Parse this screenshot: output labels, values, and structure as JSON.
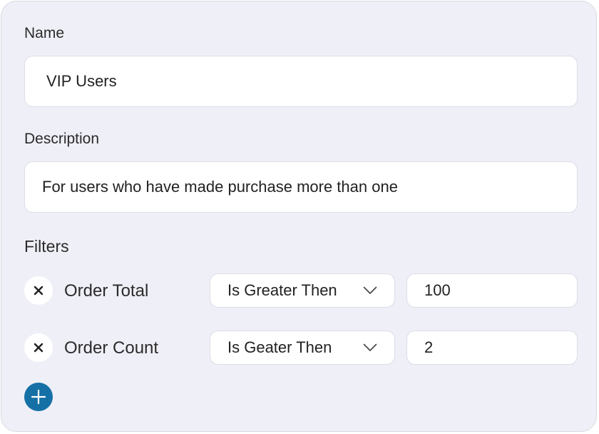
{
  "form": {
    "name_label": "Name",
    "name_value": "VIP Users",
    "description_label": "Description",
    "description_value": "For users who have made purchase more than one",
    "filters_label": "Filters"
  },
  "filters": [
    {
      "field": "Order Total",
      "operator": "Is Greater Then",
      "value": "100"
    },
    {
      "field": "Order Count",
      "operator": "Is Geater Then",
      "value": "2"
    }
  ],
  "icons": {
    "remove": "close-icon",
    "dropdown": "chevron-down-icon",
    "add": "plus-icon"
  },
  "colors": {
    "card_background": "#efeff7",
    "add_button": "#1570a6"
  }
}
